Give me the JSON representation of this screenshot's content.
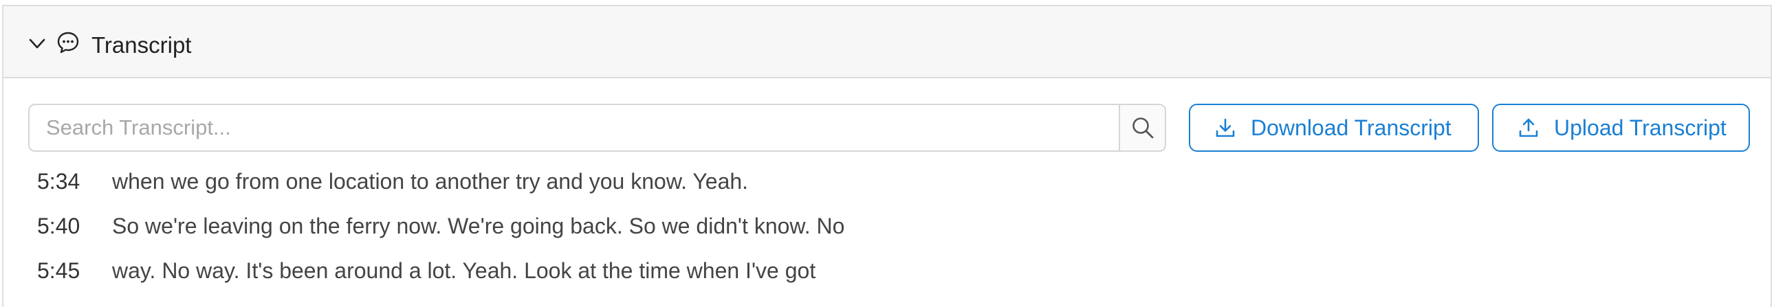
{
  "header": {
    "title": "Transcript",
    "expanded": true
  },
  "search": {
    "placeholder": "Search Transcript...",
    "value": ""
  },
  "actions": {
    "download_label": "Download Transcript",
    "upload_label": "Upload Transcript"
  },
  "colors": {
    "accent": "#1a7fd4",
    "header_bg": "#f7f7f7",
    "border": "#dcdcdc"
  },
  "transcript": [
    {
      "time": "5:34",
      "text": "when we go from one location to another try and you know. Yeah."
    },
    {
      "time": "5:40",
      "text": "So we're leaving on the ferry now. We're going back. So we didn't know. No"
    },
    {
      "time": "5:45",
      "text": "way. No way. It's been around a lot. Yeah. Look at the time when I've got"
    }
  ]
}
